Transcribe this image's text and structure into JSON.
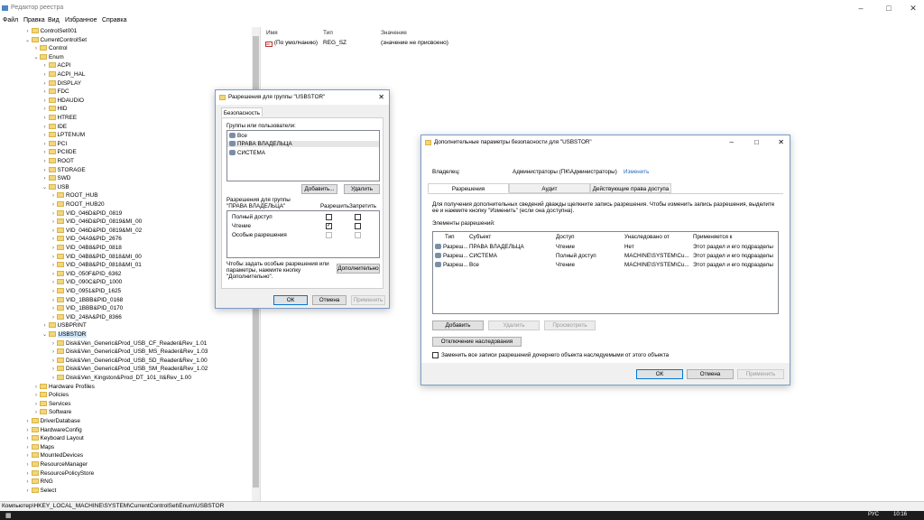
{
  "window": {
    "title": "Редактор реестра"
  },
  "menu": [
    "Файл",
    "Правка",
    "Вид",
    "Избранное",
    "Справка"
  ],
  "tree": [
    {
      "label": "ControlSet001",
      "indent": 3,
      "exp": ">"
    },
    {
      "label": "CurrentControlSet",
      "indent": 3,
      "exp": "v"
    },
    {
      "label": "Control",
      "indent": 4,
      "exp": ">"
    },
    {
      "label": "Enum",
      "indent": 4,
      "exp": "v"
    },
    {
      "label": "ACPI",
      "indent": 5,
      "exp": ">"
    },
    {
      "label": "ACPI_HAL",
      "indent": 5,
      "exp": ">"
    },
    {
      "label": "DISPLAY",
      "indent": 5,
      "exp": ">"
    },
    {
      "label": "FDC",
      "indent": 5,
      "exp": ">"
    },
    {
      "label": "HDAUDIO",
      "indent": 5,
      "exp": ">"
    },
    {
      "label": "HID",
      "indent": 5,
      "exp": ">"
    },
    {
      "label": "HTREE",
      "indent": 5,
      "exp": ">"
    },
    {
      "label": "IDE",
      "indent": 5,
      "exp": ">"
    },
    {
      "label": "LPTENUM",
      "indent": 5,
      "exp": ">"
    },
    {
      "label": "PCI",
      "indent": 5,
      "exp": ">"
    },
    {
      "label": "PCIIDE",
      "indent": 5,
      "exp": ">"
    },
    {
      "label": "ROOT",
      "indent": 5,
      "exp": ">"
    },
    {
      "label": "STORAGE",
      "indent": 5,
      "exp": ">"
    },
    {
      "label": "SWD",
      "indent": 5,
      "exp": ">"
    },
    {
      "label": "USB",
      "indent": 5,
      "exp": "v"
    },
    {
      "label": "ROOT_HUB",
      "indent": 6,
      "exp": ">"
    },
    {
      "label": "ROOT_HUB20",
      "indent": 6,
      "exp": ">"
    },
    {
      "label": "VID_046D&PID_0819",
      "indent": 6,
      "exp": ">"
    },
    {
      "label": "VID_046D&PID_0819&MI_00",
      "indent": 6,
      "exp": ">"
    },
    {
      "label": "VID_046D&PID_0819&MI_02",
      "indent": 6,
      "exp": ">"
    },
    {
      "label": "VID_04A9&PID_2676",
      "indent": 6,
      "exp": ">"
    },
    {
      "label": "VID_04B8&PID_0818",
      "indent": 6,
      "exp": ">"
    },
    {
      "label": "VID_04B8&PID_0818&MI_00",
      "indent": 6,
      "exp": ">"
    },
    {
      "label": "VID_04B8&PID_0818&MI_01",
      "indent": 6,
      "exp": ">"
    },
    {
      "label": "VID_050F&PID_6362",
      "indent": 6,
      "exp": ">"
    },
    {
      "label": "VID_090C&PID_1000",
      "indent": 6,
      "exp": ">"
    },
    {
      "label": "VID_0951&PID_1625",
      "indent": 6,
      "exp": ">"
    },
    {
      "label": "VID_1BBB&PID_0168",
      "indent": 6,
      "exp": ">"
    },
    {
      "label": "VID_1BBB&PID_0170",
      "indent": 6,
      "exp": ">"
    },
    {
      "label": "VID_248A&PID_8366",
      "indent": 6,
      "exp": ">"
    },
    {
      "label": "USBPRINT",
      "indent": 5,
      "exp": ">"
    },
    {
      "label": "USBSTOR",
      "indent": 5,
      "exp": "v",
      "selected": true
    },
    {
      "label": "Disk&Ven_Generic&Prod_USB_CF_Reader&Rev_1.01",
      "indent": 6,
      "exp": ">"
    },
    {
      "label": "Disk&Ven_Generic&Prod_USB_MS_Reader&Rev_1.03",
      "indent": 6,
      "exp": ">"
    },
    {
      "label": "Disk&Ven_Generic&Prod_USB_SD_Reader&Rev_1.00",
      "indent": 6,
      "exp": ">"
    },
    {
      "label": "Disk&Ven_Generic&Prod_USB_SM_Reader&Rev_1.02",
      "indent": 6,
      "exp": ">"
    },
    {
      "label": "Disk&Ven_Kingston&Prod_DT_101_II&Rev_1.00",
      "indent": 6,
      "exp": ">"
    },
    {
      "label": "Hardware Profiles",
      "indent": 4,
      "exp": ">"
    },
    {
      "label": "Policies",
      "indent": 4,
      "exp": ">"
    },
    {
      "label": "Services",
      "indent": 4,
      "exp": ">"
    },
    {
      "label": "Software",
      "indent": 4,
      "exp": ">"
    },
    {
      "label": "DriverDatabase",
      "indent": 3,
      "exp": ">"
    },
    {
      "label": "HardwareConfig",
      "indent": 3,
      "exp": ">"
    },
    {
      "label": "Keyboard Layout",
      "indent": 3,
      "exp": ">"
    },
    {
      "label": "Maps",
      "indent": 3,
      "exp": ">"
    },
    {
      "label": "MountedDevices",
      "indent": 3,
      "exp": ">"
    },
    {
      "label": "ResourceManager",
      "indent": 3,
      "exp": ">"
    },
    {
      "label": "ResourcePolicyStore",
      "indent": 3,
      "exp": ">"
    },
    {
      "label": "RNG",
      "indent": 3,
      "exp": ">"
    },
    {
      "label": "Select",
      "indent": 3,
      "exp": ">"
    }
  ],
  "values_pane": {
    "headers": {
      "name": "Имя",
      "type": "Тип",
      "value": "Значение"
    },
    "row": {
      "name": "(По умолчанию)",
      "type": "REG_SZ",
      "value": "(значение не присвоено)"
    }
  },
  "status": "Компьютер\\HKEY_LOCAL_MACHINE\\SYSTEM\\CurrentControlSet\\Enum\\USBSTOR",
  "taskbar": {
    "lang": "РУС",
    "time": "10:16"
  },
  "perm_dialog": {
    "title": "Разрешения для группы \"USBSTOR\"",
    "tab": "Безопасность",
    "groups_label": "Группы или пользователи:",
    "groups": [
      "Все",
      "ПРАВА ВЛАДЕЛЬЦА",
      "СИСТЕМА"
    ],
    "add": "Добавить...",
    "remove": "Удалить",
    "perms_label": "Разрешения для группы \"ПРАВА ВЛАДЕЛЬЦА\"",
    "allow": "Разрешить",
    "deny": "Запретить",
    "perms": [
      {
        "name": "Полный доступ",
        "allow": "",
        "deny": ""
      },
      {
        "name": "Чтение",
        "allow": "✓",
        "deny": ""
      },
      {
        "name": "Особые разрешения",
        "allow": "",
        "deny": ""
      }
    ],
    "special_text": "Чтобы задать особые разрешения или параметры, нажмите кнопку \"Дополнительно\".",
    "advanced": "Дополнительно",
    "ok": "ОК",
    "cancel": "Отмена",
    "apply": "Применить"
  },
  "adv_dialog": {
    "title": "Дополнительные параметры безопасности  для \"USBSTOR\"",
    "owner_label": "Владелец:",
    "owner": "Администраторы (ПК\\Администраторы)",
    "change": "Изменить",
    "tabs": [
      "Разрешения",
      "Аудит",
      "Действующие права доступа"
    ],
    "info": "Для получения дополнительных сведений дважды щелкните запись разрешения. Чтобы изменить запись разрешения, выделите ее и нажмите кнопку \"Изменить\" (если она доступна).",
    "entries_label": "Элементы разрешений:",
    "columns": [
      "Тип",
      "Субъект",
      "Доступ",
      "Унаследовано от",
      "Применяется к"
    ],
    "rows": [
      [
        "Разреш...",
        "ПРАВА ВЛАДЕЛЬЦА",
        "Чтение",
        "Нет",
        "Этот раздел и его подразделы"
      ],
      [
        "Разреш...",
        "СИСТЕМА",
        "Полный доступ",
        "MACHINE\\SYSTEM\\Cu...",
        "Этот раздел и его подразделы"
      ],
      [
        "Разреш...",
        "Все",
        "Чтение",
        "MACHINE\\SYSTEM\\Cu...",
        "Этот раздел и его подразделы"
      ]
    ],
    "add": "Добавить",
    "remove": "Удалить",
    "view": "Просмотреть",
    "disable_inherit": "Отключение наследования",
    "replace_text": "Заменить все записи разрешений дочернего объекта наследуемыми от этого объекта",
    "ok": "ОК",
    "cancel": "Отмена",
    "apply": "Применить"
  }
}
